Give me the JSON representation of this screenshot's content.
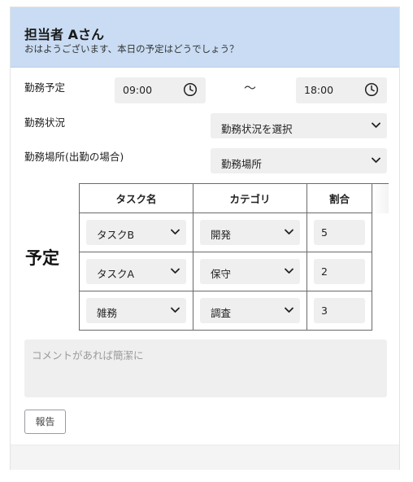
{
  "header": {
    "title": "担当者 Aさん",
    "greeting": "おはようございます、本日の予定はどうでしょう？"
  },
  "work_schedule": {
    "label": "勤務予定",
    "start_time": "09:00",
    "separator": "～",
    "end_time": "18:00"
  },
  "work_status": {
    "label": "勤務状況",
    "selected": "勤務状況を選択"
  },
  "work_location": {
    "label": "勤務場所(出勤の場合)",
    "selected": "勤務場所"
  },
  "plan": {
    "heading": "予定",
    "columns": [
      "タスク名",
      "カテゴリ",
      "割合"
    ],
    "rows": [
      {
        "task": "タスクB",
        "category": "開発",
        "ratio": "5"
      },
      {
        "task": "タスクA",
        "category": "保守",
        "ratio": "2"
      },
      {
        "task": "雑務",
        "category": "調査",
        "ratio": "3"
      }
    ]
  },
  "comment": {
    "placeholder": "コメントがあれば簡潔に"
  },
  "actions": {
    "report_label": "報告"
  },
  "icons": {
    "time": "clock-icon",
    "dropdown": "chevron-down-icon"
  },
  "colors": {
    "header_bg": "#c9dcf3",
    "field_bg": "#efefef"
  }
}
